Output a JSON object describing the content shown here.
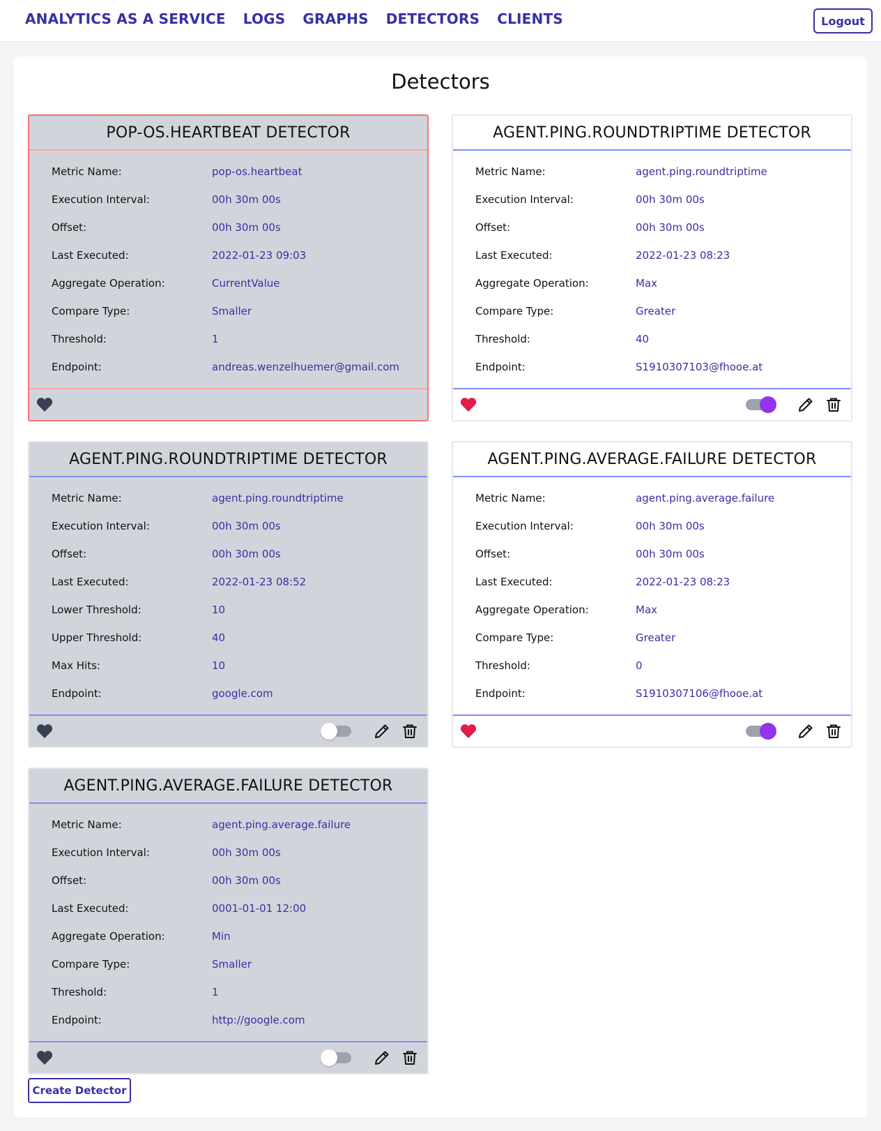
{
  "nav": {
    "links": [
      "ANALYTICS AS A SERVICE",
      "LOGS",
      "GRAPHS",
      "DETECTORS",
      "CLIENTS"
    ],
    "logout_label": "Logout"
  },
  "page": {
    "title": "Detectors",
    "create_label": "Create Detector"
  },
  "colors": {
    "accent": "#3730a3",
    "heart_active": "#e11d48",
    "heart_inactive": "#374151",
    "toggle_on": "#9333ea",
    "alert_border": "#f87171"
  },
  "detectors": [
    {
      "title": "POP-OS.HEARTBEAT DETECTOR",
      "state": "inactive",
      "alert": true,
      "favorite": false,
      "enabled": null,
      "fields": [
        {
          "label": "Metric Name:",
          "value": "pop-os.heartbeat"
        },
        {
          "label": "Execution Interval:",
          "value": "00h 30m 00s"
        },
        {
          "label": "Offset:",
          "value": "00h 30m 00s"
        },
        {
          "label": "Last Executed:",
          "value": "2022-01-23 09:03"
        },
        {
          "label": "Aggregate Operation:",
          "value": "CurrentValue"
        },
        {
          "label": "Compare Type:",
          "value": "Smaller"
        },
        {
          "label": "Threshold:",
          "value": "1"
        },
        {
          "label": "Endpoint:",
          "value": "andreas.wenzelhuemer@gmail.com"
        }
      ]
    },
    {
      "title": "AGENT.PING.ROUNDTRIPTIME DETECTOR",
      "state": "active",
      "alert": false,
      "favorite": true,
      "enabled": true,
      "fields": [
        {
          "label": "Metric Name:",
          "value": "agent.ping.roundtriptime"
        },
        {
          "label": "Execution Interval:",
          "value": "00h 30m 00s"
        },
        {
          "label": "Offset:",
          "value": "00h 30m 00s"
        },
        {
          "label": "Last Executed:",
          "value": "2022-01-23 08:23"
        },
        {
          "label": "Aggregate Operation:",
          "value": "Max"
        },
        {
          "label": "Compare Type:",
          "value": "Greater"
        },
        {
          "label": "Threshold:",
          "value": "40"
        },
        {
          "label": "Endpoint:",
          "value": "S1910307103@fhooe.at"
        }
      ]
    },
    {
      "title": "AGENT.PING.ROUNDTRIPTIME DETECTOR",
      "state": "inactive",
      "alert": false,
      "favorite": false,
      "enabled": false,
      "fields": [
        {
          "label": "Metric Name:",
          "value": "agent.ping.roundtriptime"
        },
        {
          "label": "Execution Interval:",
          "value": "00h 30m 00s"
        },
        {
          "label": "Offset:",
          "value": "00h 30m 00s"
        },
        {
          "label": "Last Executed:",
          "value": "2022-01-23 08:52"
        },
        {
          "label": "Lower Threshold:",
          "value": "10"
        },
        {
          "label": "Upper Threshold:",
          "value": "40"
        },
        {
          "label": "Max Hits:",
          "value": "10"
        },
        {
          "label": "Endpoint:",
          "value": "google.com"
        }
      ]
    },
    {
      "title": "AGENT.PING.AVERAGE.FAILURE DETECTOR",
      "state": "active",
      "alert": false,
      "favorite": true,
      "enabled": true,
      "fields": [
        {
          "label": "Metric Name:",
          "value": "agent.ping.average.failure"
        },
        {
          "label": "Execution Interval:",
          "value": "00h 30m 00s"
        },
        {
          "label": "Offset:",
          "value": "00h 30m 00s"
        },
        {
          "label": "Last Executed:",
          "value": "2022-01-23 08:23"
        },
        {
          "label": "Aggregate Operation:",
          "value": "Max"
        },
        {
          "label": "Compare Type:",
          "value": "Greater"
        },
        {
          "label": "Threshold:",
          "value": "0"
        },
        {
          "label": "Endpoint:",
          "value": "S1910307106@fhooe.at"
        }
      ]
    },
    {
      "title": "AGENT.PING.AVERAGE.FAILURE DETECTOR",
      "state": "inactive",
      "alert": false,
      "favorite": false,
      "enabled": false,
      "fields": [
        {
          "label": "Metric Name:",
          "value": "agent.ping.average.failure"
        },
        {
          "label": "Execution Interval:",
          "value": "00h 30m 00s"
        },
        {
          "label": "Offset:",
          "value": "00h 30m 00s"
        },
        {
          "label": "Last Executed:",
          "value": "0001-01-01 12:00"
        },
        {
          "label": "Aggregate Operation:",
          "value": "Min"
        },
        {
          "label": "Compare Type:",
          "value": "Smaller"
        },
        {
          "label": "Threshold:",
          "value": "1"
        },
        {
          "label": "Endpoint:",
          "value": "http://google.com"
        }
      ]
    }
  ]
}
